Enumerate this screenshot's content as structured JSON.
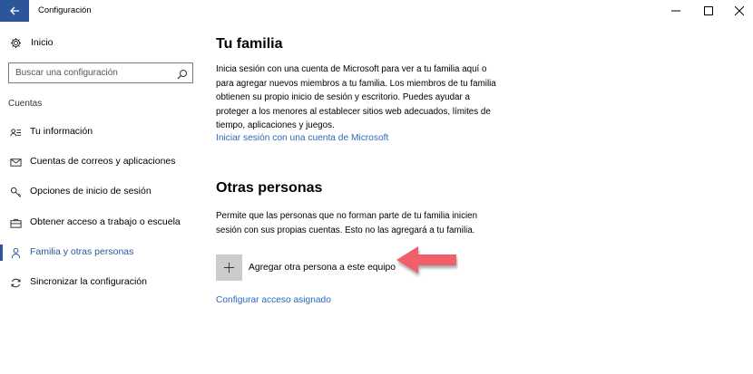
{
  "window": {
    "title": "Configuración",
    "back_icon": "arrow-left-icon",
    "controls": [
      "minimize-icon",
      "maximize-icon",
      "close-icon"
    ]
  },
  "sidebar": {
    "home": {
      "label": "Inicio",
      "icon": "gear-icon"
    },
    "search": {
      "placeholder": "Buscar una configuración",
      "icon": "search-icon"
    },
    "section_label": "Cuentas",
    "items": [
      {
        "label": "Tu información",
        "icon": "person-card-icon",
        "selected": false
      },
      {
        "label": "Cuentas de correos y aplicaciones",
        "icon": "mail-icon",
        "selected": false
      },
      {
        "label": "Opciones de inicio de sesión",
        "icon": "key-icon",
        "selected": false
      },
      {
        "label": "Obtener acceso a trabajo o escuela",
        "icon": "briefcase-icon",
        "selected": false
      },
      {
        "label": "Familia y otras personas",
        "icon": "person-icon",
        "selected": true
      },
      {
        "label": "Sincronizar la configuración",
        "icon": "sync-icon",
        "selected": false
      }
    ],
    "accent_color": "#2b579a"
  },
  "main": {
    "family": {
      "title": "Tu familia",
      "description": "Inicia sesión con una cuenta de Microsoft para ver a tu familia aquí o para agregar nuevos miembros a tu familia. Los miembros de tu familia obtienen su propio inicio de sesión y escritorio. Puedes ayudar a proteger a los menores al establecer sitios web adecuados, límites de tiempo, aplicaciones y juegos.",
      "link": "Iniciar sesión con una cuenta de Microsoft"
    },
    "others": {
      "title": "Otras personas",
      "description": "Permite que las personas que no forman parte de tu familia inicien sesión con sus propias cuentas. Esto no las agregará a tu familia.",
      "add_label": "Agregar otra persona a este equipo",
      "add_icon": "plus-icon",
      "link": "Configurar acceso asignado"
    },
    "link_color": "#2b6ab8"
  },
  "annotation": {
    "icon": "red-arrow-icon",
    "color": "#f0616a"
  }
}
